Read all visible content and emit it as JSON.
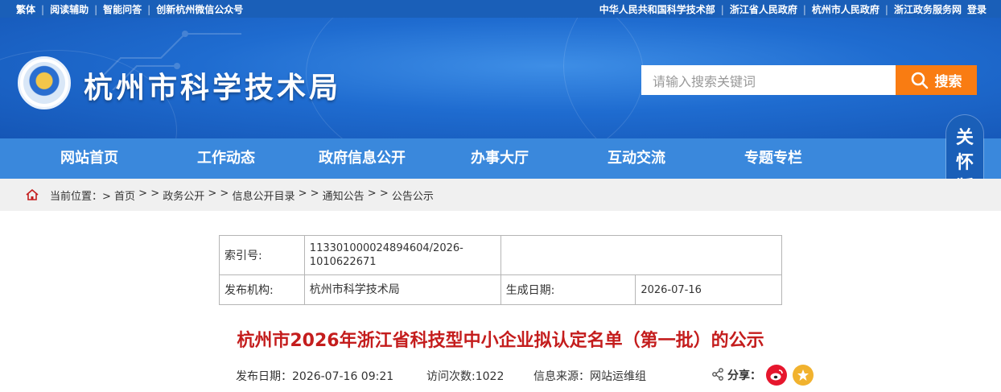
{
  "topbar": {
    "left": [
      "繁体",
      "阅读辅助",
      "智能问答",
      "创新杭州微信公众号"
    ],
    "right": [
      "中华人民共和国科学技术部",
      "浙江省人民政府",
      "杭州市人民政府",
      "浙江政务服务网",
      "登录"
    ]
  },
  "header": {
    "site_title": "杭州市科学技术局",
    "search_placeholder": "请输入搜索关键词",
    "search_button": "搜索"
  },
  "nav": {
    "items": [
      "网站首页",
      "工作动态",
      "政府信息公开",
      "办事大厅",
      "互动交流",
      "专题专栏"
    ]
  },
  "care_mode": [
    "关",
    "怀",
    "版"
  ],
  "breadcrumb": {
    "prefix": "当前位置：> ",
    "items": [
      "首页",
      "政务公开",
      "信息公开目录",
      "通知公告",
      "公告公示"
    ],
    "separator": " > > "
  },
  "meta": {
    "index_label": "索引号:",
    "index_value": "113301000024894604/2026-1010622671",
    "publisher_label": "发布机构:",
    "publisher_value": "杭州市科学技术局",
    "date_label": "生成日期:",
    "date_value": "2026-07-16"
  },
  "article": {
    "title": "杭州市2026年浙江省科技型中小企业拟认定名单（第一批）的公示",
    "publish_date": "发布日期：2026-07-16 09:21",
    "visits": "访问次数:1022",
    "source": "信息来源：网站运维组",
    "share_label": "分享："
  },
  "colors": {
    "topbar": "#1a5fb8",
    "nav": "#3a88dc",
    "search_button": "#f97c12",
    "title_red": "#c41d1d"
  }
}
